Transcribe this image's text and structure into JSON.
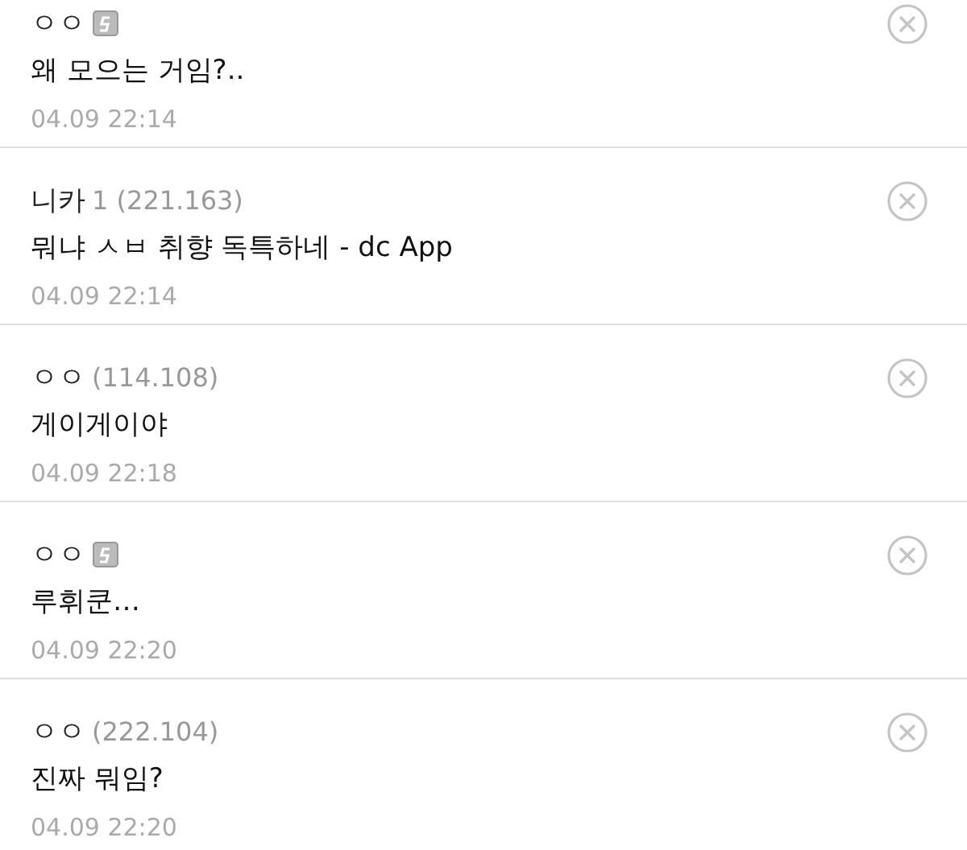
{
  "comments": [
    {
      "name": "ㅇㅇ",
      "kind": "member",
      "text": "왜 모으는 거임?..",
      "date": "04.09 22:14"
    },
    {
      "name": "니카",
      "kind": "guest",
      "ip": "1 (221.163)",
      "text": "뭐냐 ㅅㅂ 취향 독특하네 - dc App",
      "date": "04.09 22:14"
    },
    {
      "name": "ㅇㅇ",
      "kind": "guest",
      "ip": "(114.108)",
      "text": "게이게이야",
      "date": "04.09 22:18"
    },
    {
      "name": "ㅇㅇ",
      "kind": "member",
      "text": "루휘쿤…",
      "date": "04.09 22:20"
    },
    {
      "name": "ㅇㅇ",
      "kind": "guest",
      "ip": "(222.104)",
      "text": "진짜 뭐임?",
      "date": "04.09 22:20"
    }
  ]
}
